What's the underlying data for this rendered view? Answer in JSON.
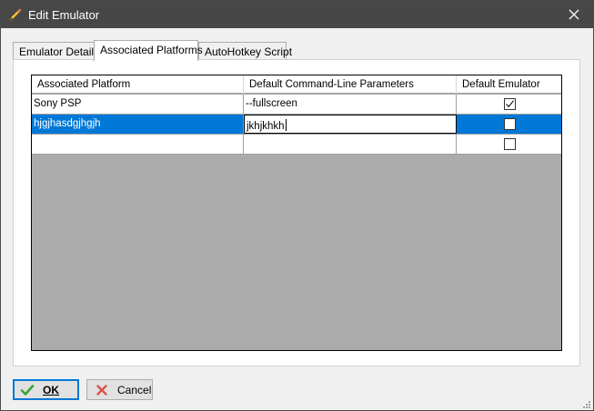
{
  "window": {
    "title": "Edit Emulator",
    "icon": "pencil-icon"
  },
  "tabs": [
    {
      "label": "Emulator Details",
      "active": false
    },
    {
      "label": "Associated Platforms",
      "active": true
    },
    {
      "label": "AutoHotkey Script",
      "active": false
    }
  ],
  "grid": {
    "columns": [
      "Associated Platform",
      "Default Command-Line Parameters",
      "Default Emulator"
    ],
    "rows": [
      {
        "platform": "Sony PSP",
        "params": "--fullscreen",
        "default": true,
        "selected": false
      },
      {
        "platform": "hjgjhasdgjhgjh",
        "params": "jkhjkhkh",
        "default": false,
        "selected": true
      },
      {
        "platform": "",
        "params": "",
        "default": false,
        "selected": false
      }
    ]
  },
  "buttons": {
    "ok": {
      "label": "OK",
      "icon": "checkmark-icon",
      "accent": "#0078d7"
    },
    "cancel": {
      "label": "Cancel",
      "icon": "x-icon",
      "accent": "#d9534f"
    }
  },
  "colors": {
    "titlebar": "#474747",
    "selection": "#0078d7",
    "grid_background": "#ababab"
  }
}
